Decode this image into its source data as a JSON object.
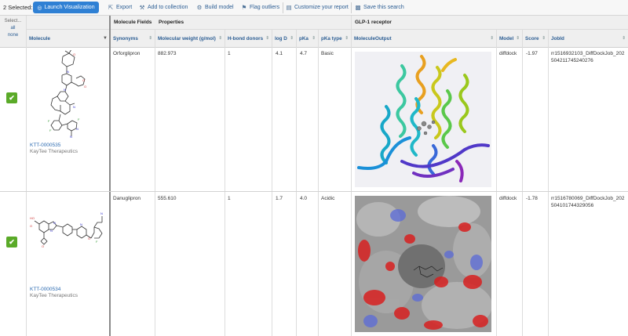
{
  "toolbar": {
    "selected": "2 Selected:",
    "launch": "Launch Visualization",
    "export": "Export",
    "add_collection": "Add to collection",
    "build_model": "Build model",
    "flag_outliers": "Flag outliers",
    "customize": "Customize your report",
    "save_search": "Save this search"
  },
  "selector": {
    "label": "Select...",
    "all": "all",
    "none": "none"
  },
  "groups": {
    "molecule_fields": "Molecule Fields",
    "properties": "Properties",
    "glp": "GLP-1 receptor"
  },
  "columns": {
    "molecule": "Molecule",
    "synonyms": "Synonyms",
    "mw": "Molecular weight (g/mol)",
    "hbd": "H-bond donors",
    "logd": "log D",
    "pka": "pKa",
    "pka_type": "pKa type",
    "output": "MoleculeOutput",
    "model": "Model",
    "score": "Score",
    "jobid": "JobId"
  },
  "rows": [
    {
      "id": "KTT-0000535",
      "company": "KayTee Therapeutics",
      "synonym": "Orforglipron",
      "mw": "882.973",
      "hbd": "1",
      "logd": "4.1",
      "pka": "4.7",
      "pka_type": "Basic",
      "model": "diffdock",
      "score": "-1.97",
      "jobid": "rr1516932103_DiffDockJob_202504211745240276"
    },
    {
      "id": "KTT-0000534",
      "company": "KayTee Therapeutics",
      "synonym": "Danuglipron",
      "mw": "555.610",
      "hbd": "1",
      "logd": "1.7",
      "pka": "4.0",
      "pka_type": "Acidic",
      "model": "diffdock",
      "score": "-1.78",
      "jobid": "rr1516780069_DiffDockJob_202504101744329056"
    }
  ],
  "accent": "#2f80d4",
  "check_color": "#5aaa28"
}
